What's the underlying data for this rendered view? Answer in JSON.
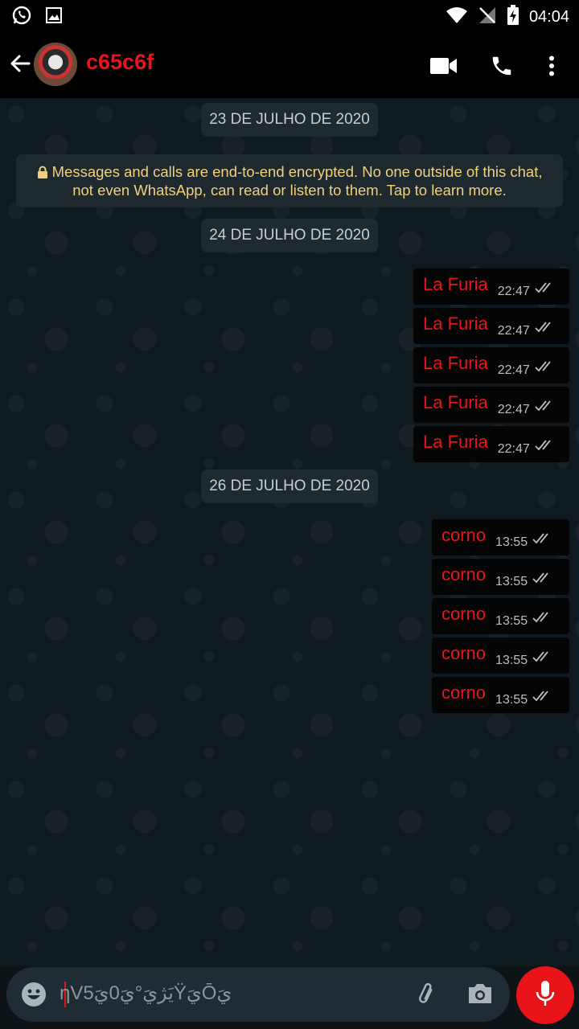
{
  "status_bar": {
    "time": "04:04"
  },
  "header": {
    "contact_name": "c65c6f"
  },
  "chat": {
    "date_chips": [
      "23 DE JULHO DE 2020",
      "24 DE JULHO DE 2020",
      "26 DE JULHO DE 2020"
    ],
    "encryption_notice_line1": "Messages and calls are end-to-end encrypted. No one outside of this chat,",
    "encryption_notice_line2": "not even WhatsApp, can read or listen to them. Tap to learn more.",
    "group1": [
      {
        "text": "La Furia",
        "time": "22:47"
      },
      {
        "text": "La Furia",
        "time": "22:47"
      },
      {
        "text": "La Furia",
        "time": "22:47"
      },
      {
        "text": "La Furia",
        "time": "22:47"
      },
      {
        "text": "La Furia",
        "time": "22:47"
      }
    ],
    "group2": [
      {
        "text": "corno",
        "time": "13:55"
      },
      {
        "text": "corno",
        "time": "13:55"
      },
      {
        "text": "corno",
        "time": "13:55"
      },
      {
        "text": "corno",
        "time": "13:55"
      },
      {
        "text": "corno",
        "time": "13:55"
      }
    ]
  },
  "composer": {
    "typed_text": "ƞV5يَژيَ°يَ0يَŸيَŌيَ"
  },
  "colors": {
    "accent": "#e8141a",
    "app_bar": "#000000",
    "bubble": "#050505",
    "notice_text": "#f1d07a"
  }
}
